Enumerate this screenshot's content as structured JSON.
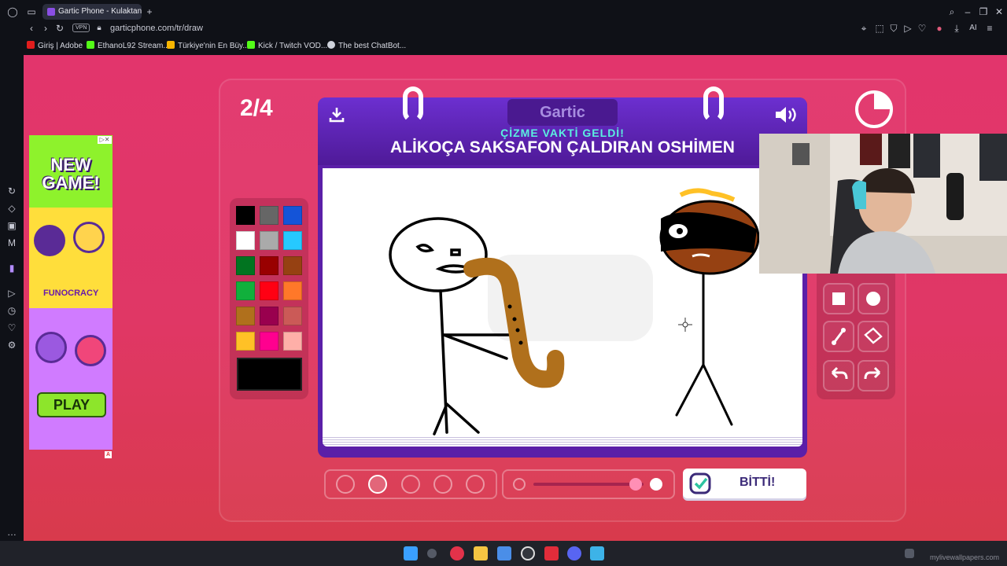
{
  "browser": {
    "tab_title": "Gartic Phone - Kulaktan Ku",
    "url": "garticphone.com/tr/draw",
    "vpn_label": "VPN",
    "new_tab_symbol": "+",
    "ai_label": "AI",
    "bookmarks": [
      {
        "label": "Giriş | Adobe",
        "color": "#e11d1d"
      },
      {
        "label": "EthanoL92 Stream...",
        "color": "#53fc18"
      },
      {
        "label": "Türkiye'nin En Büy...",
        "color": "#f7b500"
      },
      {
        "label": "Kick / Twitch VOD...",
        "color": "#53fc18"
      },
      {
        "label": "The best ChatBot...",
        "color": "#cfd3dc"
      }
    ]
  },
  "game": {
    "round": "2/4",
    "logo": "Gartic",
    "subtitle": "ÇİZME VAKTİ GELDİ!",
    "prompt": "ALİKOÇA SAKSAFON ÇALDIRAN OSHİMEN",
    "done_label": "BİTTİ!",
    "selected_color": "#000000",
    "colors": [
      "#000000",
      "#666666",
      "#1454d8",
      "#ffffff",
      "#aaaaaa",
      "#26c9ff",
      "#017420",
      "#990000",
      "#964112",
      "#11b03c",
      "#ff0013",
      "#ff7829",
      "#b0701c",
      "#99004e",
      "#cb5a57",
      "#ffc126",
      "#ff008f",
      "#feafa8"
    ],
    "tools": [
      "square-tool-icon",
      "circle-tool-icon",
      "line-tool-icon",
      "fill-bucket-icon",
      "undo-icon",
      "redo-icon"
    ]
  },
  "ad": {
    "headline": "NEW GAME!",
    "brand": "FUNOCRACY",
    "cta": "PLAY",
    "badge": "A"
  },
  "system": {
    "watermark": "mylivewallpapers.com"
  }
}
